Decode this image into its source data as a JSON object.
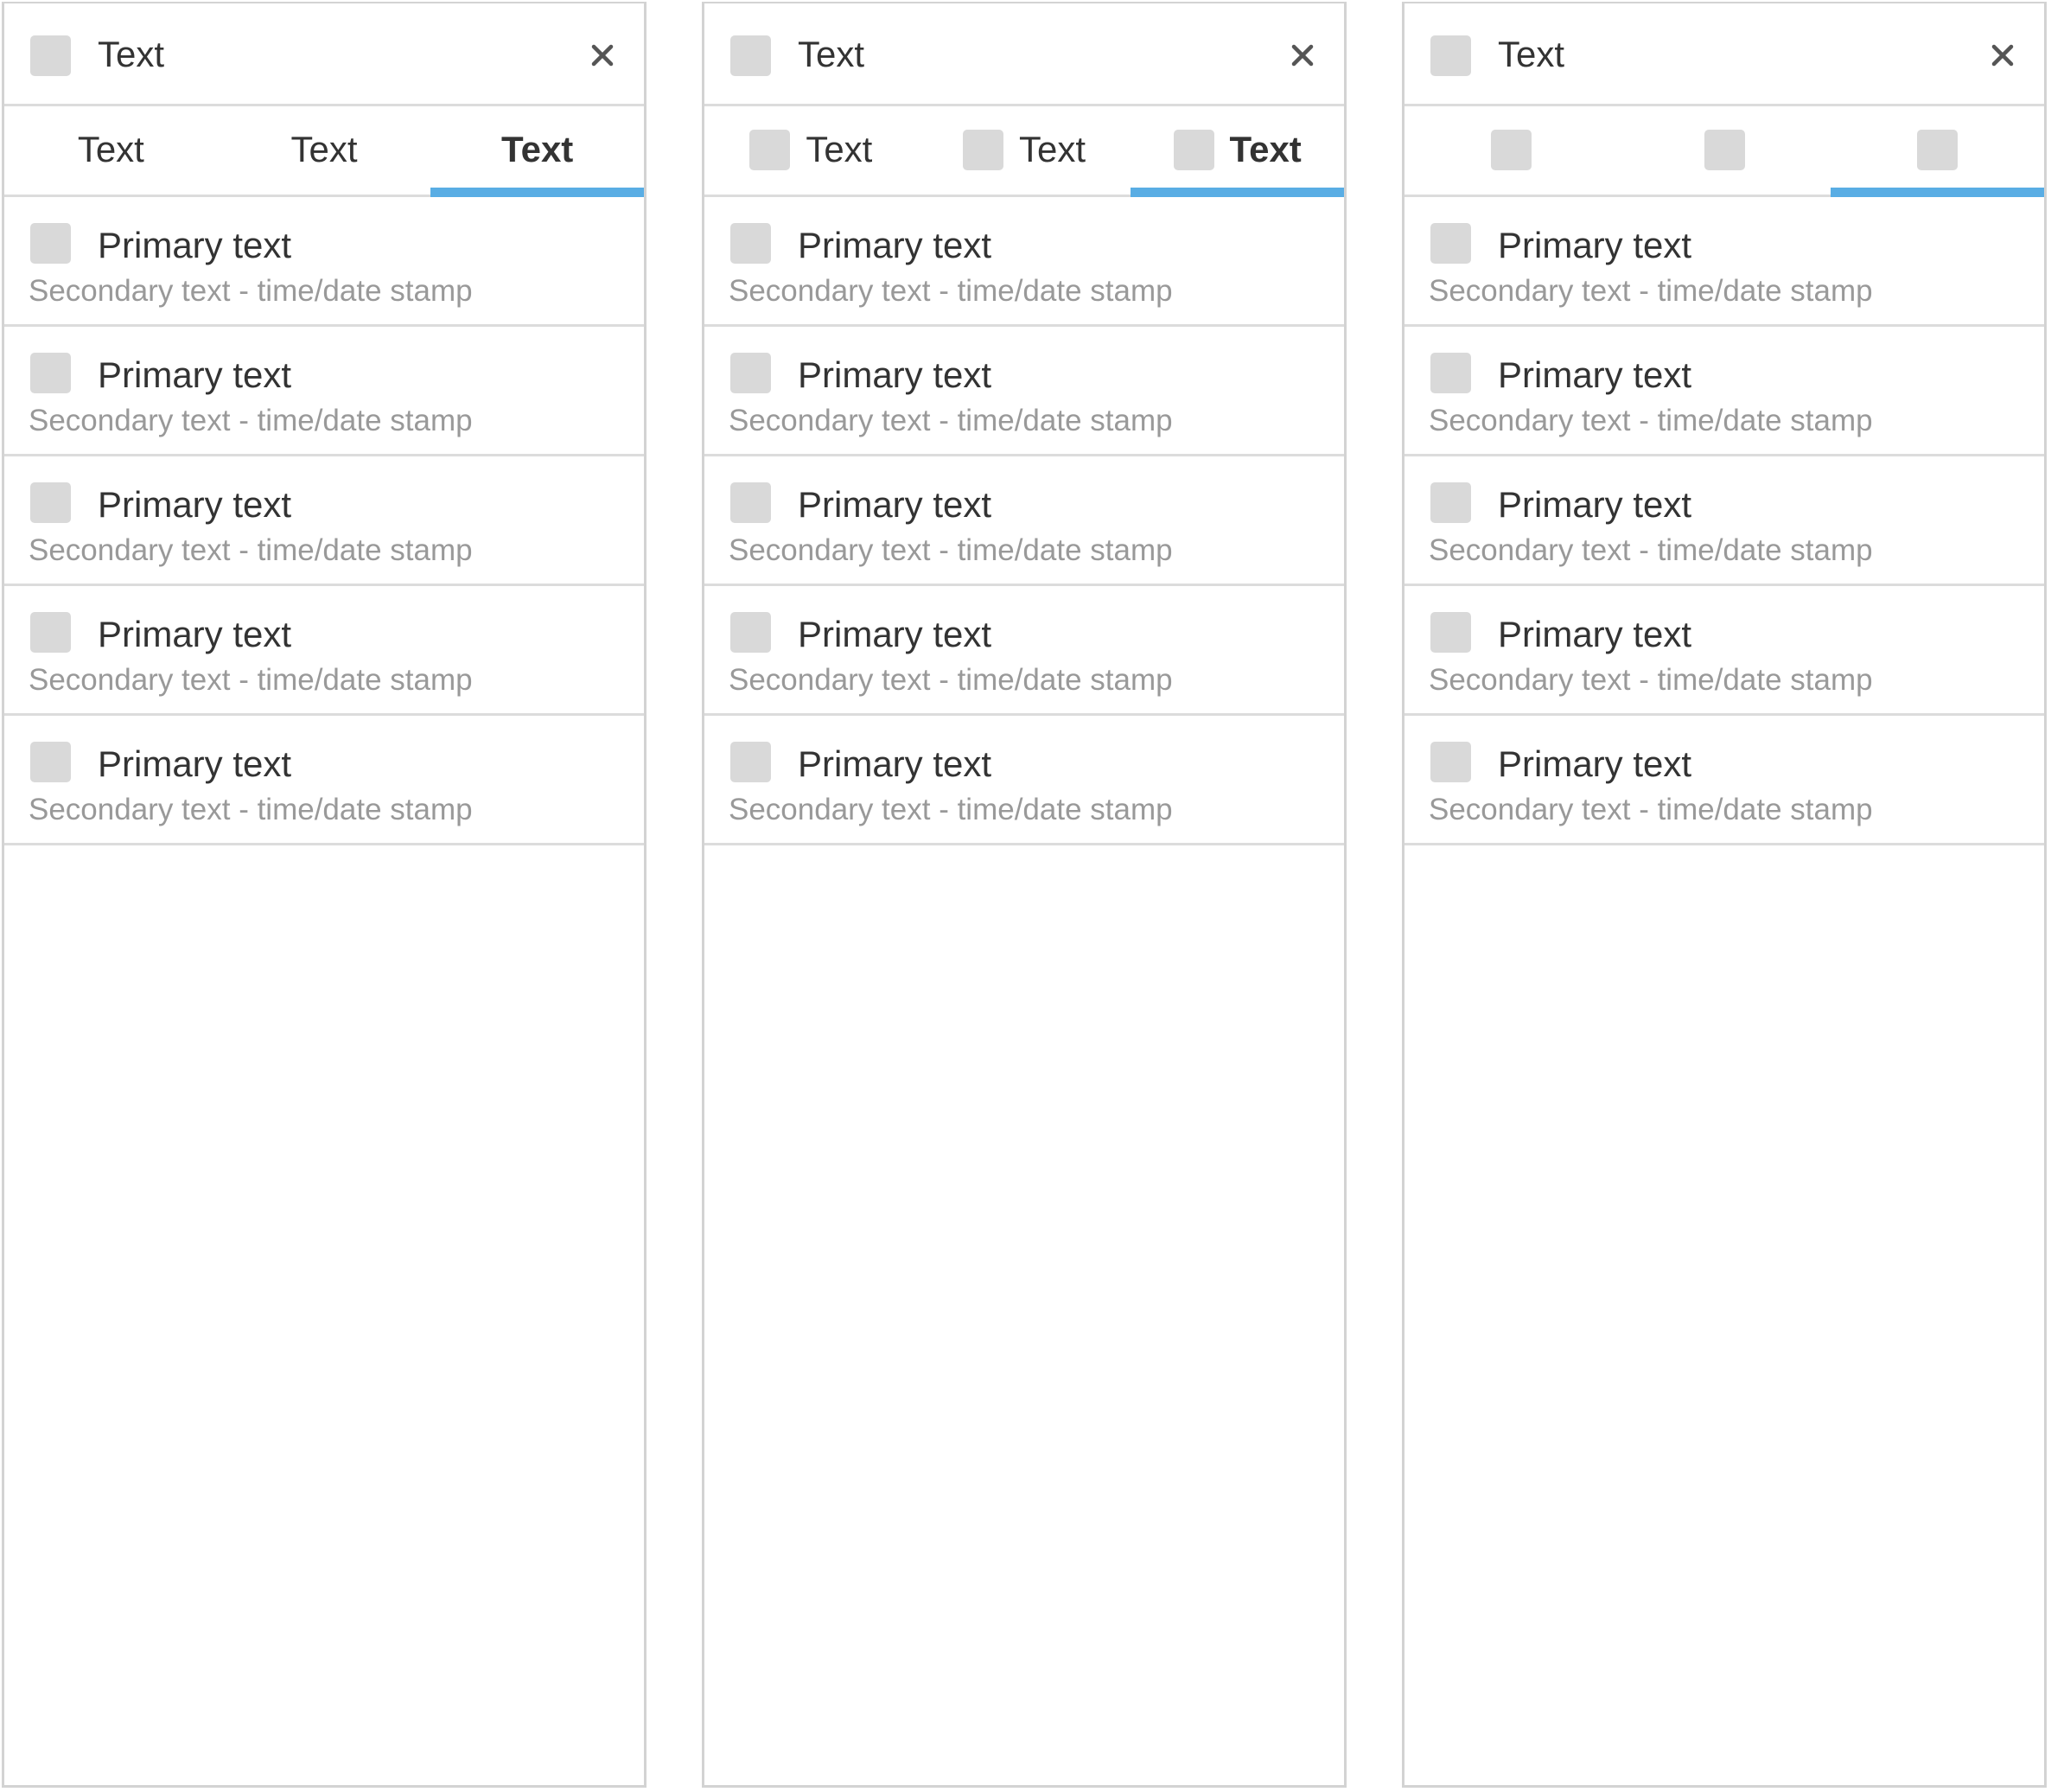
{
  "panels": [
    {
      "header": {
        "title": "Text",
        "close_glyph": "×"
      },
      "tab_style": "text-only",
      "tabs": [
        {
          "label": "Text",
          "active": false
        },
        {
          "label": "Text",
          "active": false
        },
        {
          "label": "Text",
          "active": true
        }
      ],
      "items": [
        {
          "primary": "Primary text",
          "secondary": "Secondary text - time/date stamp"
        },
        {
          "primary": "Primary text",
          "secondary": "Secondary text - time/date stamp"
        },
        {
          "primary": "Primary text",
          "secondary": "Secondary text - time/date stamp"
        },
        {
          "primary": "Primary text",
          "secondary": "Secondary text - time/date stamp"
        },
        {
          "primary": "Primary text",
          "secondary": "Secondary text - time/date stamp"
        }
      ]
    },
    {
      "header": {
        "title": "Text",
        "close_glyph": "×"
      },
      "tab_style": "icon-and-text",
      "tabs": [
        {
          "label": "Text",
          "active": false
        },
        {
          "label": "Text",
          "active": false
        },
        {
          "label": "Text",
          "active": true
        }
      ],
      "items": [
        {
          "primary": "Primary text",
          "secondary": "Secondary text - time/date stamp"
        },
        {
          "primary": "Primary text",
          "secondary": "Secondary text - time/date stamp"
        },
        {
          "primary": "Primary text",
          "secondary": "Secondary text - time/date stamp"
        },
        {
          "primary": "Primary text",
          "secondary": "Secondary text - time/date stamp"
        },
        {
          "primary": "Primary text",
          "secondary": "Secondary text - time/date stamp"
        }
      ]
    },
    {
      "header": {
        "title": "Text",
        "close_glyph": "×"
      },
      "tab_style": "icon-only",
      "tabs": [
        {
          "label": "",
          "active": false
        },
        {
          "label": "",
          "active": false
        },
        {
          "label": "",
          "active": true
        }
      ],
      "items": [
        {
          "primary": "Primary text",
          "secondary": "Secondary text - time/date stamp"
        },
        {
          "primary": "Primary text",
          "secondary": "Secondary text - time/date stamp"
        },
        {
          "primary": "Primary text",
          "secondary": "Secondary text - time/date stamp"
        },
        {
          "primary": "Primary text",
          "secondary": "Secondary text - time/date stamp"
        },
        {
          "primary": "Primary text",
          "secondary": "Secondary text - time/date stamp"
        }
      ]
    }
  ],
  "colors": {
    "accent": "#59ade4",
    "placeholder_icon": "#d9d9d9",
    "divider": "#dcdcdc",
    "primary_text": "#333333",
    "secondary_text": "#999999"
  },
  "icons": {
    "header": "placeholder-icon",
    "close": "close-icon",
    "tab": "placeholder-icon",
    "list_item": "placeholder-icon"
  }
}
